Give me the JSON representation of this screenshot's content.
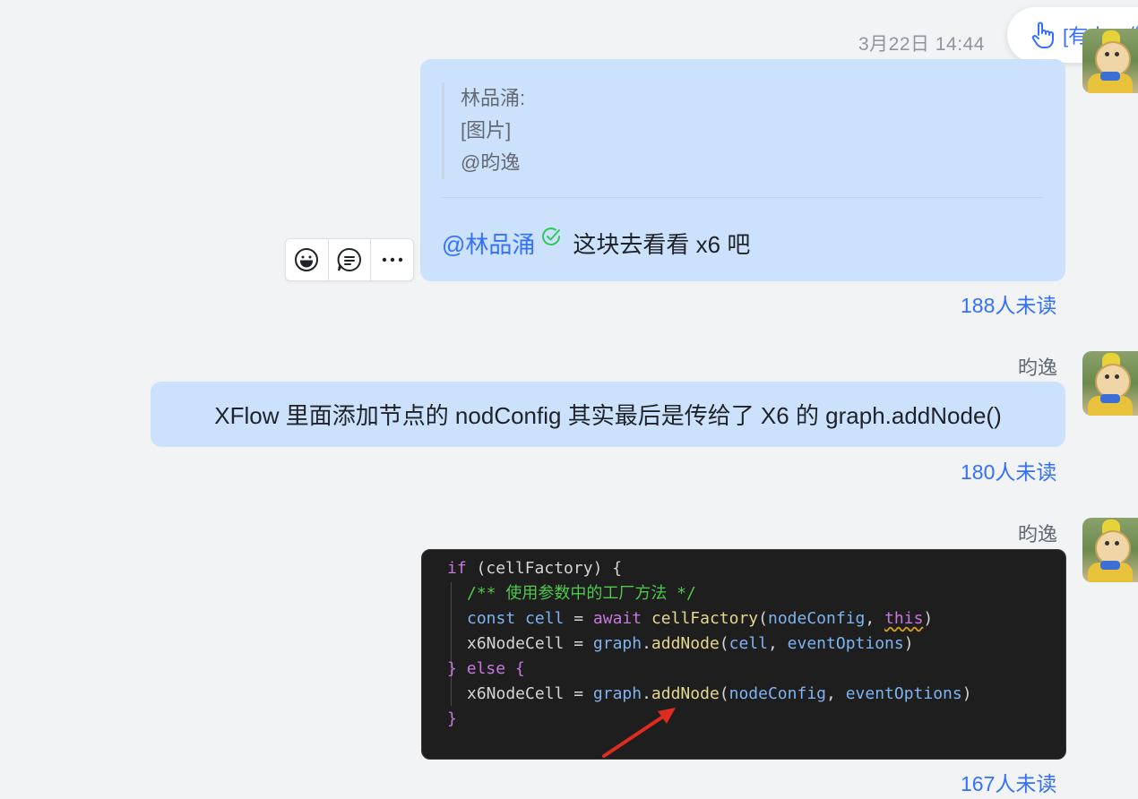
{
  "header": {
    "timestamp": "3月22日 14:44",
    "mention_notice": "[有人@你]"
  },
  "messages": [
    {
      "quote": {
        "author": "林品涌:",
        "content": "[图片]",
        "mention": "@昀逸"
      },
      "mention": "@林品涌",
      "text": "这块去看看 x6 吧",
      "unread": "188人未读"
    },
    {
      "sender": "昀逸",
      "text": "XFlow 里面添加节点的 nodConfig 其实最后是传给了 X6 的 graph.addNode()",
      "unread": "180人未读"
    },
    {
      "sender": "昀逸",
      "code": {
        "if_kw": "if",
        "if_cond": " (cellFactory) {",
        "comment": "/** 使用参数中的工厂方法 */",
        "const_kw": "const",
        "cell_var": "cell",
        "eq": " = ",
        "await_kw": "await",
        "cellFactory_fn": "cellFactory",
        "open_paren": "(",
        "nodeConfig": "nodeConfig",
        "comma": ", ",
        "this_kw": "this",
        "close_paren": ")",
        "x6NodeCell": "x6NodeCell",
        "graph": "graph",
        "dot": ".",
        "addNode": "addNode",
        "cell_arg": "cell",
        "eventOptions": "eventOptions",
        "else_close": "} ",
        "else_kw": "else",
        "else_open": " {",
        "close_brace": "}"
      },
      "unread": "167人未读"
    }
  ],
  "toolbar": {
    "icons": [
      "emoji-icon",
      "reply-icon",
      "more-icon"
    ]
  }
}
